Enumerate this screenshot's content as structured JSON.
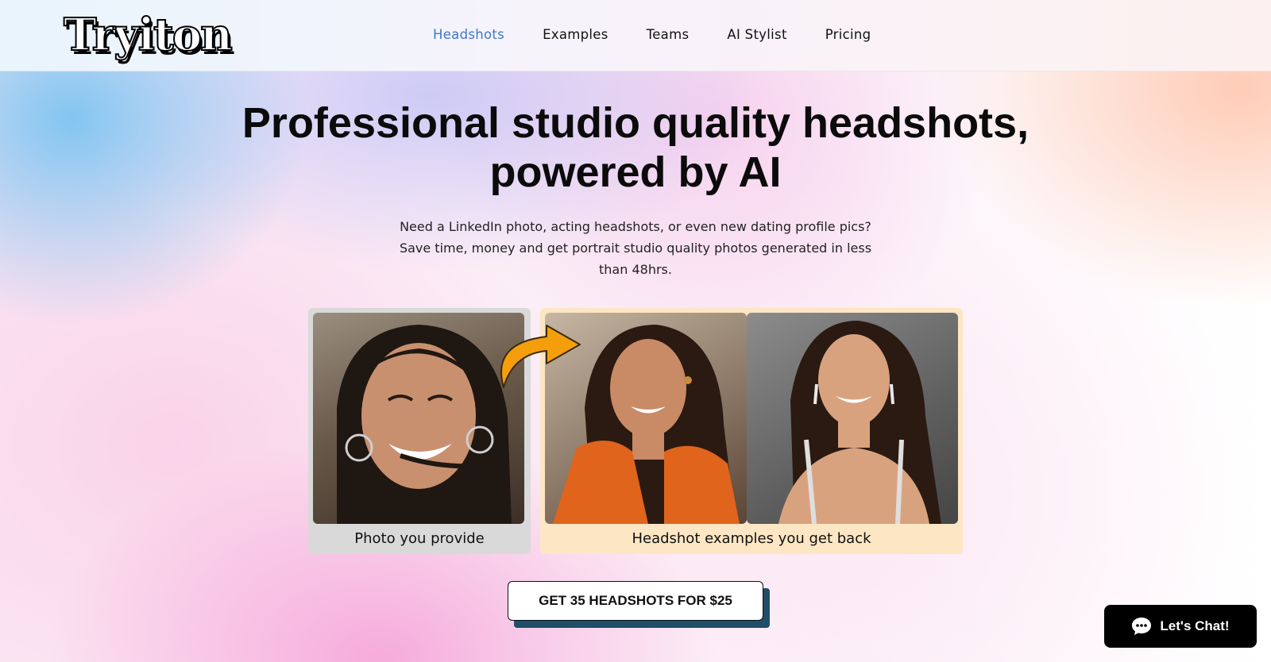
{
  "header": {
    "logo_text": "Tryiton",
    "nav": [
      {
        "label": "Headshots",
        "active": true
      },
      {
        "label": "Examples",
        "active": false
      },
      {
        "label": "Teams",
        "active": false
      },
      {
        "label": "AI Stylist",
        "active": false
      },
      {
        "label": "Pricing",
        "active": false
      }
    ]
  },
  "hero": {
    "title_line1": "Professional studio quality headshots,",
    "title_line2": "powered by AI",
    "subtitle_line1": "Need a LinkedIn photo, acting headshots, or even new dating profile pics?",
    "subtitle_line2": "Save time, money and get portrait studio quality photos generated in less",
    "subtitle_line3": "than 48hrs."
  },
  "comparison": {
    "provide_caption": "Photo you provide",
    "back_caption": "Headshot examples you get back",
    "arrow_icon": "curved-arrow-icon",
    "arrow_color": "#f59e0b"
  },
  "cta": {
    "label": "GET 35 HEADSHOTS FOR $25"
  },
  "chat": {
    "label": "Let's Chat!",
    "icon": "chat-bubble-icon"
  },
  "colors": {
    "nav_active": "#3d78c8",
    "provide_card": "#d9d9d9",
    "back_card": "#fde6c4",
    "cta_shadow": "#1f4e68",
    "chat_bg": "#000000"
  }
}
